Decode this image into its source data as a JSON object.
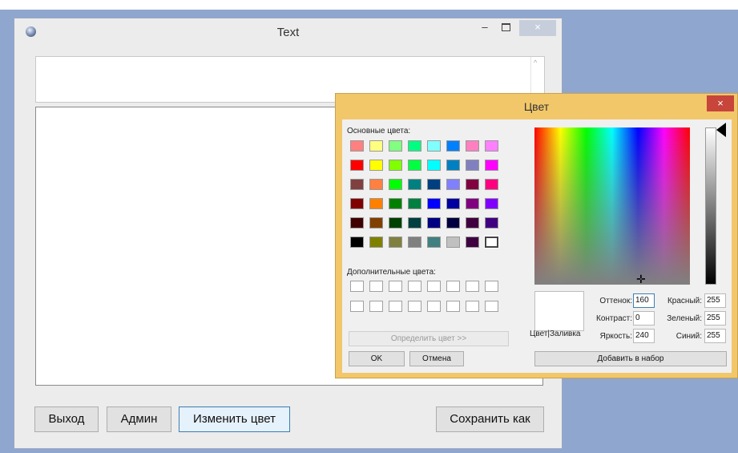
{
  "main_window": {
    "title": "Text",
    "controls": {
      "minimize": "–",
      "maximize": "□",
      "close": "×"
    },
    "buttons": {
      "exit": "Выход",
      "admin": "Админ",
      "change_color": "Изменить цвет",
      "save_as": "Сохранить как"
    }
  },
  "color_dialog": {
    "title": "Цвет",
    "close": "×",
    "basic_colors_label": "Основные цвета:",
    "basic_colors": [
      "#ff8080",
      "#ffff80",
      "#80ff80",
      "#00ff80",
      "#80ffff",
      "#0080ff",
      "#ff80c0",
      "#ff80ff",
      "#ff0000",
      "#ffff00",
      "#80ff00",
      "#00ff40",
      "#00ffff",
      "#0080c0",
      "#8080c0",
      "#ff00ff",
      "#804040",
      "#ff8040",
      "#00ff00",
      "#008080",
      "#004080",
      "#8080ff",
      "#800040",
      "#ff0080",
      "#800000",
      "#ff8000",
      "#008000",
      "#008040",
      "#0000ff",
      "#0000a0",
      "#800080",
      "#8000ff",
      "#400000",
      "#804000",
      "#004000",
      "#004040",
      "#000080",
      "#000040",
      "#400040",
      "#400080",
      "#000000",
      "#808000",
      "#808040",
      "#808080",
      "#408080",
      "#c0c0c0",
      "#400040",
      "#ffffff"
    ],
    "custom_colors_label": "Дополнительные цвета:",
    "define_button": "Определить цвет >>",
    "ok_button": "OK",
    "cancel_button": "Отмена",
    "preview_label": "Цвет|Заливка",
    "fields": {
      "hue_label": "Оттенок:",
      "hue": "160",
      "sat_label": "Контраст:",
      "sat": "0",
      "lum_label": "Яркость:",
      "lum": "240",
      "red_label": "Красный:",
      "red": "255",
      "green_label": "Зеленый:",
      "green": "255",
      "blue_label": "Синий:",
      "blue": "255"
    },
    "add_button": "Добавить в набор"
  }
}
